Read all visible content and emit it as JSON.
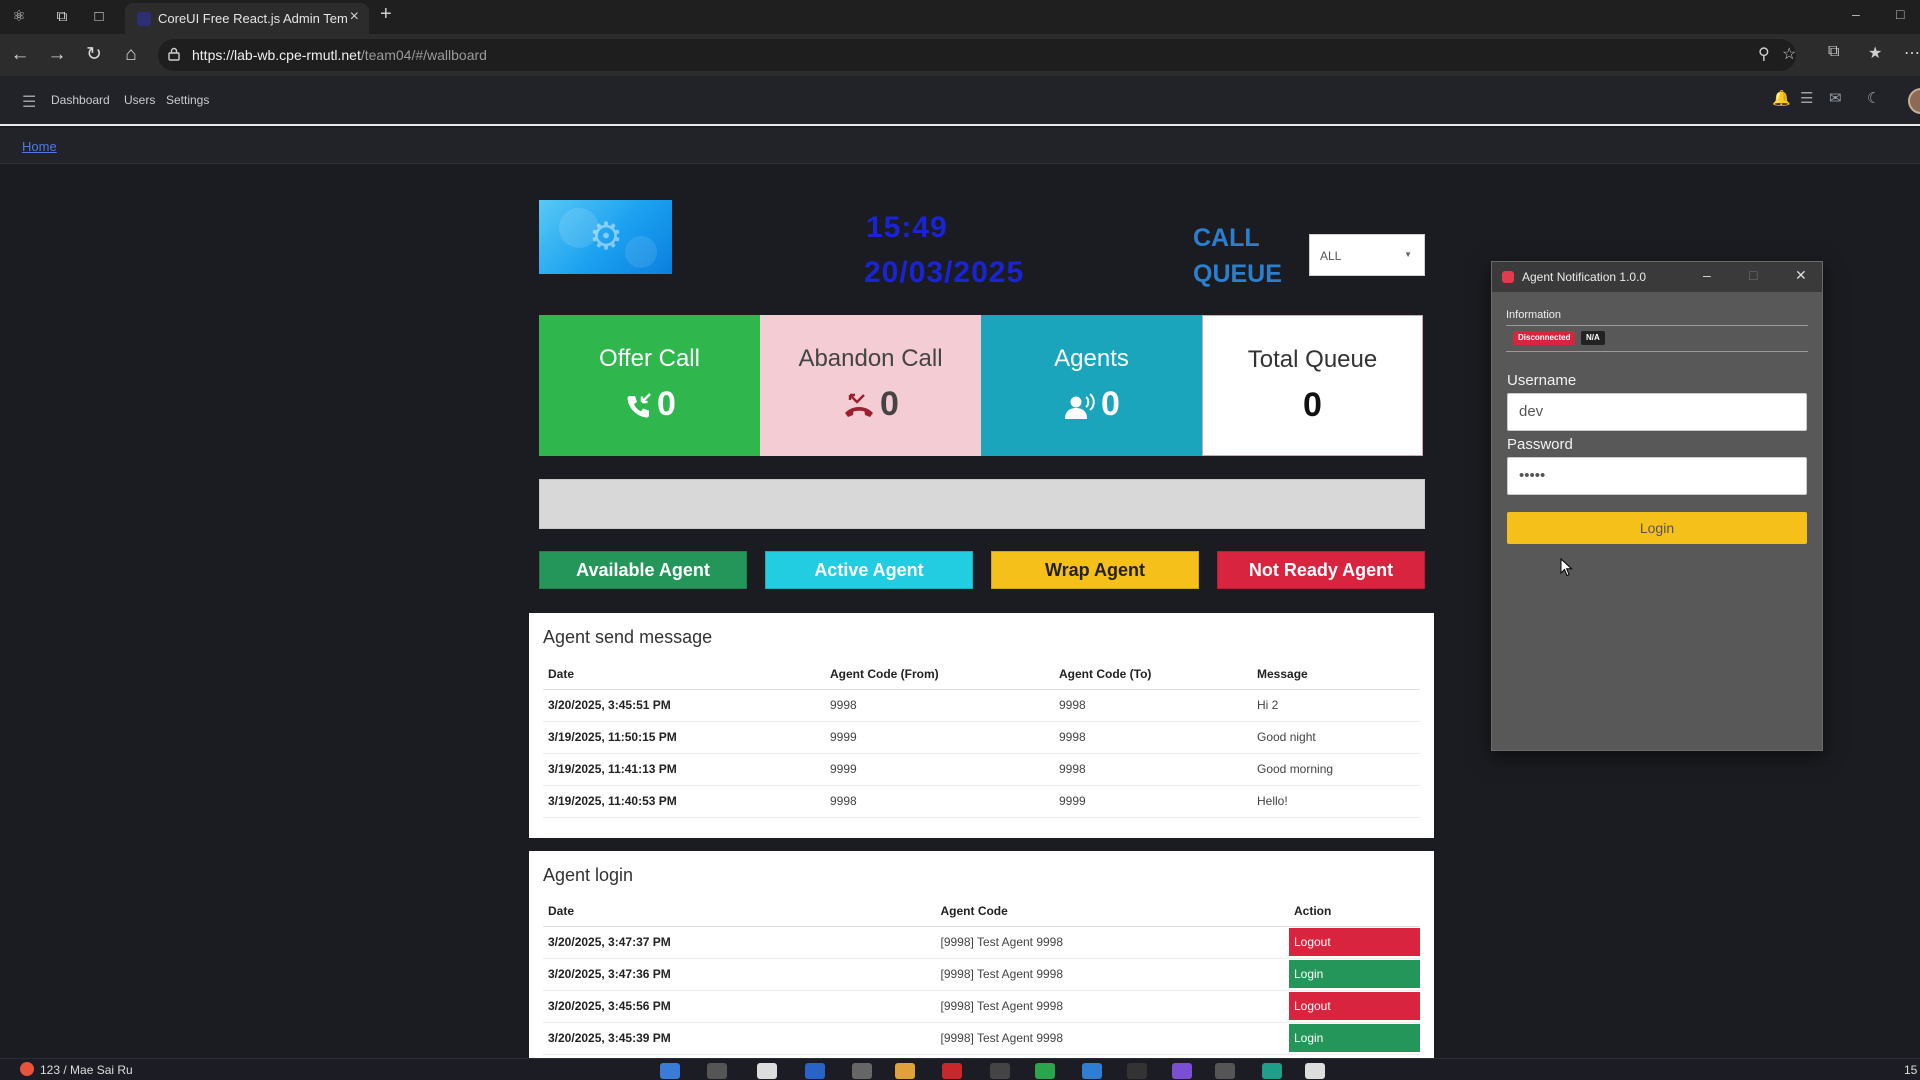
{
  "browser": {
    "tab_title": "CoreUI Free React.js Admin Temp",
    "url_host": "https://lab-wb.cpe-rmutl.net",
    "url_path": "/team04/#/wallboard"
  },
  "header": {
    "nav": [
      "Dashboard",
      "Users",
      "Settings"
    ],
    "icons": [
      "bell-icon",
      "list-icon",
      "envelope-icon",
      "moon-icon",
      "avatar"
    ]
  },
  "breadcrumb": {
    "home": "Home"
  },
  "wallboard": {
    "time": "15:49",
    "date": "20/03/2025",
    "call_queue_line1": "CALL",
    "call_queue_line2": "QUEUE",
    "queue_select": "ALL",
    "stats": {
      "offer_call": {
        "label": "Offer Call",
        "value": "0",
        "icon": "phone-incoming-icon",
        "color": "#2fb64d"
      },
      "abandon_call": {
        "label": "Abandon Call",
        "value": "0",
        "icon": "phone-missed-icon",
        "color": "#f3ccd4"
      },
      "agents": {
        "label": "Agents",
        "value": "0",
        "icon": "agents-icon",
        "color": "#1aa5bd"
      },
      "total_queue": {
        "label": "Total Queue",
        "value": "0"
      }
    },
    "agent_buttons": {
      "available": "Available Agent",
      "active": "Active Agent",
      "wrap": "Wrap Agent",
      "not_ready": "Not Ready Agent"
    }
  },
  "agent_send_message": {
    "title": "Agent send message",
    "columns": [
      "Date",
      "Agent Code (From)",
      "Agent Code (To)",
      "Message"
    ],
    "rows": [
      [
        "3/20/2025, 3:45:51 PM",
        "9998",
        "9998",
        "Hi 2"
      ],
      [
        "3/19/2025, 11:50:15 PM",
        "9999",
        "9998",
        "Good night"
      ],
      [
        "3/19/2025, 11:41:13 PM",
        "9999",
        "9998",
        "Good morning"
      ],
      [
        "3/19/2025, 11:40:53 PM",
        "9998",
        "9999",
        "Hello!"
      ]
    ]
  },
  "agent_login": {
    "title": "Agent login",
    "columns": [
      "Date",
      "Agent Code",
      "Action"
    ],
    "rows": [
      [
        "3/20/2025, 3:47:37 PM",
        "[9998] Test Agent 9998",
        "Logout"
      ],
      [
        "3/20/2025, 3:47:36 PM",
        "[9998] Test Agent 9998",
        "Login"
      ],
      [
        "3/20/2025, 3:45:56 PM",
        "[9998] Test Agent 9998",
        "Logout"
      ],
      [
        "3/20/2025, 3:45:39 PM",
        "[9998] Test Agent 9998",
        "Login"
      ]
    ]
  },
  "notification_window": {
    "title": "Agent Notification 1.0.0",
    "section": "Information",
    "status_badge": "Disconnected",
    "na_badge": "N/A",
    "username_label": "Username",
    "username_value": "dev",
    "password_label": "Password",
    "password_value": "•••••",
    "login_button": "Login"
  },
  "taskbar": {
    "weather": "123 / Mae Sai Ru",
    "time": "15"
  },
  "colors": {
    "available": "#25965a",
    "active": "#22cde2",
    "wrap": "#f5c019",
    "not_ready": "#d8243f",
    "clock": "#1a23d6",
    "call_queue": "#2a7fd0"
  }
}
